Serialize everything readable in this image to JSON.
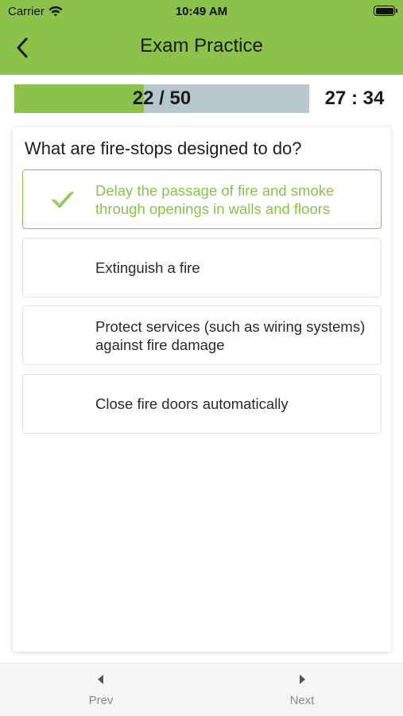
{
  "status_bar": {
    "carrier": "Carrier",
    "time": "10:49 AM"
  },
  "nav": {
    "title": "Exam Practice"
  },
  "progress": {
    "text": "22 / 50",
    "current": 22,
    "total": 50,
    "fraction": 0.44,
    "fill_color": "#8bc34a",
    "track_color": "#b6c8cd"
  },
  "timer": {
    "text": "27 : 34"
  },
  "question": {
    "text": "What are fire-stops designed to do?",
    "options": [
      {
        "label": "Delay the passage of fire and smoke through openings in walls and floors",
        "state": "correct",
        "icon": "check-icon"
      },
      {
        "label": "Extinguish a fire",
        "state": "default"
      },
      {
        "label": "Protect services (such as wiring systems) against fire damage",
        "state": "default"
      },
      {
        "label": "Close fire doors automatically",
        "state": "default"
      }
    ]
  },
  "footer": {
    "prev_label": "Prev",
    "next_label": "Next"
  },
  "colors": {
    "accent": "#8bc34a",
    "correct_text": "#8bc34a"
  }
}
